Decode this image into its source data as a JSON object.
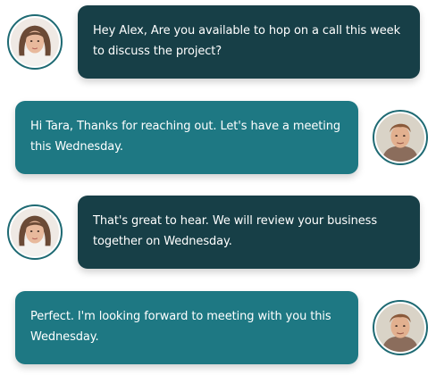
{
  "messages": [
    {
      "sender": "Tara",
      "side": "left",
      "style": "dark",
      "text": "Hey Alex, Are you available to hop on a call this week to discuss the project?"
    },
    {
      "sender": "Alex",
      "side": "right",
      "style": "teal",
      "text": "Hi Tara, Thanks for reaching out. Let's have a meeting this Wednesday."
    },
    {
      "sender": "Tara",
      "side": "left",
      "style": "dark",
      "text": "That's great to hear. We will review your business together on Wednesday."
    },
    {
      "sender": "Alex",
      "side": "right",
      "style": "teal",
      "text": "Perfect. I'm looking forward to meeting with you this Wednesday."
    }
  ],
  "colors": {
    "dark_bubble": "#173f47",
    "teal_bubble": "#1e7883",
    "avatar_ring": "#1e6a73",
    "text": "#ffffff"
  },
  "icons": {
    "tara": "woman-avatar-icon",
    "alex": "man-avatar-icon"
  }
}
